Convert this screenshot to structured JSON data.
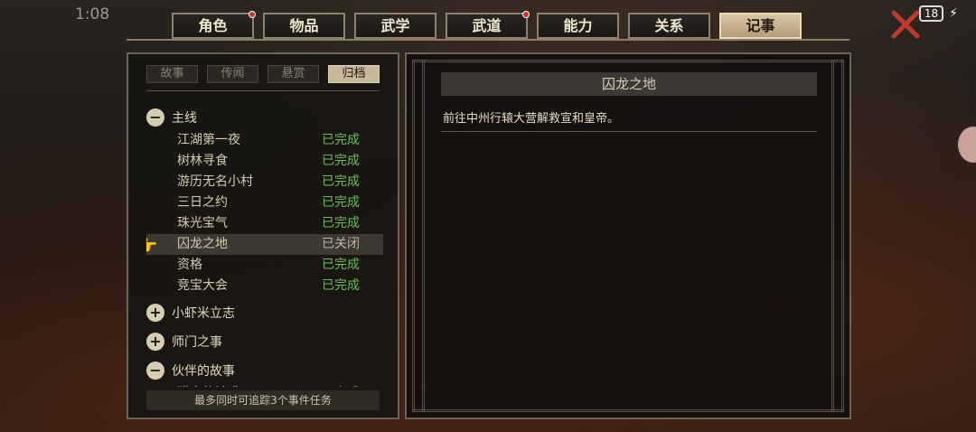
{
  "status_bar": {
    "time": "1:08",
    "battery": "18"
  },
  "tabs": [
    {
      "label": "角色",
      "badge": true
    },
    {
      "label": "物品",
      "badge": false
    },
    {
      "label": "武学",
      "badge": false
    },
    {
      "label": "武道",
      "badge": true
    },
    {
      "label": "能力",
      "badge": false
    },
    {
      "label": "关系",
      "badge": false
    },
    {
      "label": "记事",
      "badge": false,
      "active": true
    }
  ],
  "subtabs": [
    {
      "label": "故事"
    },
    {
      "label": "传闻"
    },
    {
      "label": "悬赏"
    },
    {
      "label": "归档",
      "active": true
    }
  ],
  "tree": {
    "groups": [
      {
        "symbol": "−",
        "label": "主线",
        "items": [
          {
            "name": "江湖第一夜",
            "status": "已完成"
          },
          {
            "name": "树林寻食",
            "status": "已完成"
          },
          {
            "name": "游历无名小村",
            "status": "已完成"
          },
          {
            "name": "三日之约",
            "status": "已完成"
          },
          {
            "name": "珠光宝气",
            "status": "已完成"
          },
          {
            "name": "囚龙之地",
            "status": "已关闭",
            "selected": true
          },
          {
            "name": "资格",
            "status": "已完成"
          },
          {
            "name": "竞宝大会",
            "status": "已完成"
          }
        ]
      },
      {
        "symbol": "+",
        "label": "小虾米立志",
        "items": []
      },
      {
        "symbol": "+",
        "label": "师门之事",
        "items": []
      },
      {
        "symbol": "−",
        "label": "伙伴的故事",
        "items": [
          {
            "name": "猎户的请求",
            "status": "已完成"
          }
        ]
      }
    ]
  },
  "footer": "最多同时可追踪3个事件任务",
  "detail": {
    "title": "囚龙之地",
    "description": "前往中州行辕大营解救宣和皇帝。"
  },
  "colors": {
    "completed": "#6dbb5c",
    "closed": "#bdb3a0",
    "active_tab": "#c8b89a"
  }
}
